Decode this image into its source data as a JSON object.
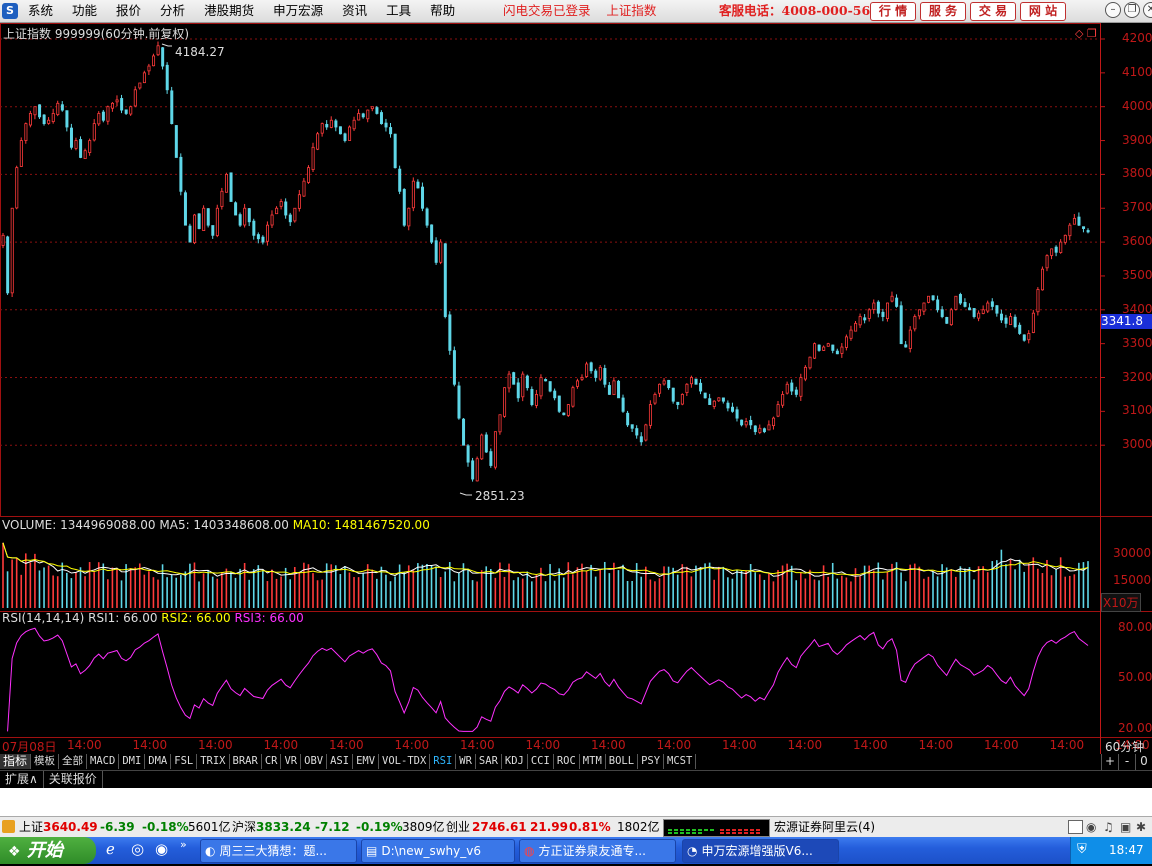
{
  "menu": {
    "items": [
      "系统",
      "功能",
      "报价",
      "分析",
      "港股期货",
      "申万宏源",
      "资讯",
      "工具",
      "帮助"
    ],
    "status_login": "闪电交易已登录",
    "status_index": "上证指数",
    "hotline": "客服电话：4008-000-562",
    "quick_buttons": [
      "行 情",
      "服 务",
      "交 易",
      "网 站"
    ]
  },
  "chart": {
    "header": "上证指数 999999(60分钟.前复权)",
    "high_label": "4184.27",
    "low_label": "2851.23",
    "current_price_tag": "3341.8",
    "price_axis": [
      "4200",
      "4100",
      "4000",
      "3900",
      "3800",
      "3700",
      "3600",
      "3500",
      "3400",
      "3300",
      "3200",
      "3100",
      "3000"
    ],
    "colors": {
      "up": "#ff3b3b",
      "down": "#5fd7e8",
      "grid": "#8a1010",
      "axis": "#c01818"
    }
  },
  "volume": {
    "label_name": "VOLUME: 1344969088.00",
    "label_ma5": "MA5: 1403348608.00",
    "label_ma10": "MA10: 1481467520.00",
    "axis": [
      "30000",
      "15000"
    ],
    "unit": "X10万"
  },
  "rsi": {
    "label_name": "RSI(14,14,14)",
    "label_rsi1": "RSI1: 66.00",
    "label_rsi2": "RSI2: 66.00",
    "label_rsi3": "RSI3: 66.00",
    "axis": [
      "80.00",
      "50.00",
      "20.00"
    ]
  },
  "time_axis": {
    "first": "07月08日",
    "labels": [
      "14:00",
      "14:00",
      "14:00",
      "14:00",
      "14:00",
      "14:00",
      "14:00",
      "14:00",
      "14:00",
      "14:00",
      "14:00",
      "14:00",
      "14:00",
      "14:00",
      "14:00",
      "14:00",
      "14:00"
    ],
    "period": "60分钟",
    "plus": "+",
    "minus": "-",
    "zero": "0"
  },
  "indicator_tabs": [
    "指标",
    "模板",
    "全部",
    "MACD",
    "DMI",
    "DMA",
    "FSL",
    "TRIX",
    "BRAR",
    "CR",
    "VR",
    "OBV",
    "ASI",
    "EMV",
    "VOL-TDX",
    "RSI",
    "WR",
    "SAR",
    "KDJ",
    "CCI",
    "ROC",
    "MTM",
    "BOLL",
    "PSY",
    "MCST"
  ],
  "active_tab": "RSI",
  "sub_tabs": [
    "扩展∧",
    "关联报价"
  ],
  "statusbar": {
    "sh_label": "上证",
    "sh_value": "3640.49",
    "sh_change": "-6.39",
    "sh_pct": "-0.18%",
    "sh_amount": "5601亿",
    "hs_label": "沪深",
    "hs_value": "3833.24",
    "hs_change": "-7.12",
    "hs_pct": "-0.19%",
    "hs_amount": "3809亿",
    "cy_label": "创业",
    "cy_value": "2746.61",
    "cy_change": "21.99",
    "cy_pct": "0.81%",
    "cy_amount": "1802亿",
    "server": "宏源证券阿里云(4)"
  },
  "taskbar": {
    "start": "开始",
    "buttons": [
      "周三三大猜想：题...",
      "D:\\new_swhy_v6",
      "方正证券泉友通专...",
      "申万宏源增强版V6..."
    ],
    "clock": "18:47"
  },
  "chart_data": {
    "type": "candlestick",
    "title": "上证指数 999999(60分钟.前复权)",
    "y_range": [
      2851.23,
      4184.27
    ],
    "close": [
      3620,
      3450,
      3700,
      3820,
      3900,
      3950,
      3980,
      4000,
      3970,
      3950,
      3960,
      3980,
      4010,
      3990,
      3940,
      3880,
      3900,
      3850,
      3870,
      3900,
      3950,
      3980,
      3960,
      4000,
      4010,
      4020,
      3990,
      3980,
      4000,
      4050,
      4070,
      4100,
      4120,
      4150,
      4180,
      4120,
      4050,
      3950,
      3850,
      3750,
      3650,
      3600,
      3680,
      3640,
      3700,
      3650,
      3620,
      3700,
      3750,
      3800,
      3720,
      3680,
      3650,
      3700,
      3660,
      3620,
      3610,
      3600,
      3650,
      3680,
      3700,
      3720,
      3680,
      3660,
      3700,
      3740,
      3780,
      3820,
      3880,
      3920,
      3950,
      3940,
      3960,
      3940,
      3920,
      3900,
      3940,
      3960,
      3980,
      3970,
      3990,
      4000,
      3980,
      3950,
      3940,
      3920,
      3820,
      3750,
      3650,
      3700,
      3780,
      3760,
      3700,
      3650,
      3600,
      3540,
      3600,
      3380,
      3280,
      3180,
      3080,
      3000,
      2950,
      2900,
      2960,
      3030,
      2980,
      2940,
      3040,
      3090,
      3170,
      3210,
      3180,
      3140,
      3210,
      3170,
      3120,
      3150,
      3200,
      3190,
      3160,
      3140,
      3100,
      3090,
      3120,
      3170,
      3190,
      3200,
      3240,
      3220,
      3200,
      3230,
      3180,
      3150,
      3190,
      3140,
      3100,
      3060,
      3050,
      3030,
      3010,
      3060,
      3120,
      3150,
      3180,
      3190,
      3170,
      3130,
      3120,
      3150,
      3180,
      3200,
      3180,
      3160,
      3140,
      3120,
      3130,
      3140,
      3130,
      3110,
      3100,
      3080,
      3060,
      3070,
      3060,
      3040,
      3050,
      3040,
      3060,
      3080,
      3120,
      3150,
      3180,
      3160,
      3150,
      3200,
      3230,
      3260,
      3300,
      3280,
      3290,
      3300,
      3280,
      3270,
      3290,
      3320,
      3340,
      3360,
      3380,
      3370,
      3400,
      3420,
      3390,
      3380,
      3420,
      3440,
      3410,
      3300,
      3290,
      3340,
      3380,
      3400,
      3420,
      3440,
      3430,
      3400,
      3380,
      3360,
      3400,
      3440,
      3420,
      3410,
      3400,
      3380,
      3390,
      3400,
      3420,
      3410,
      3390,
      3370,
      3360,
      3380,
      3350,
      3330,
      3310,
      3330,
      3390,
      3460,
      3520,
      3560,
      3580,
      3570,
      3600,
      3620,
      3650,
      3670,
      3650,
      3640,
      3630
    ]
  }
}
